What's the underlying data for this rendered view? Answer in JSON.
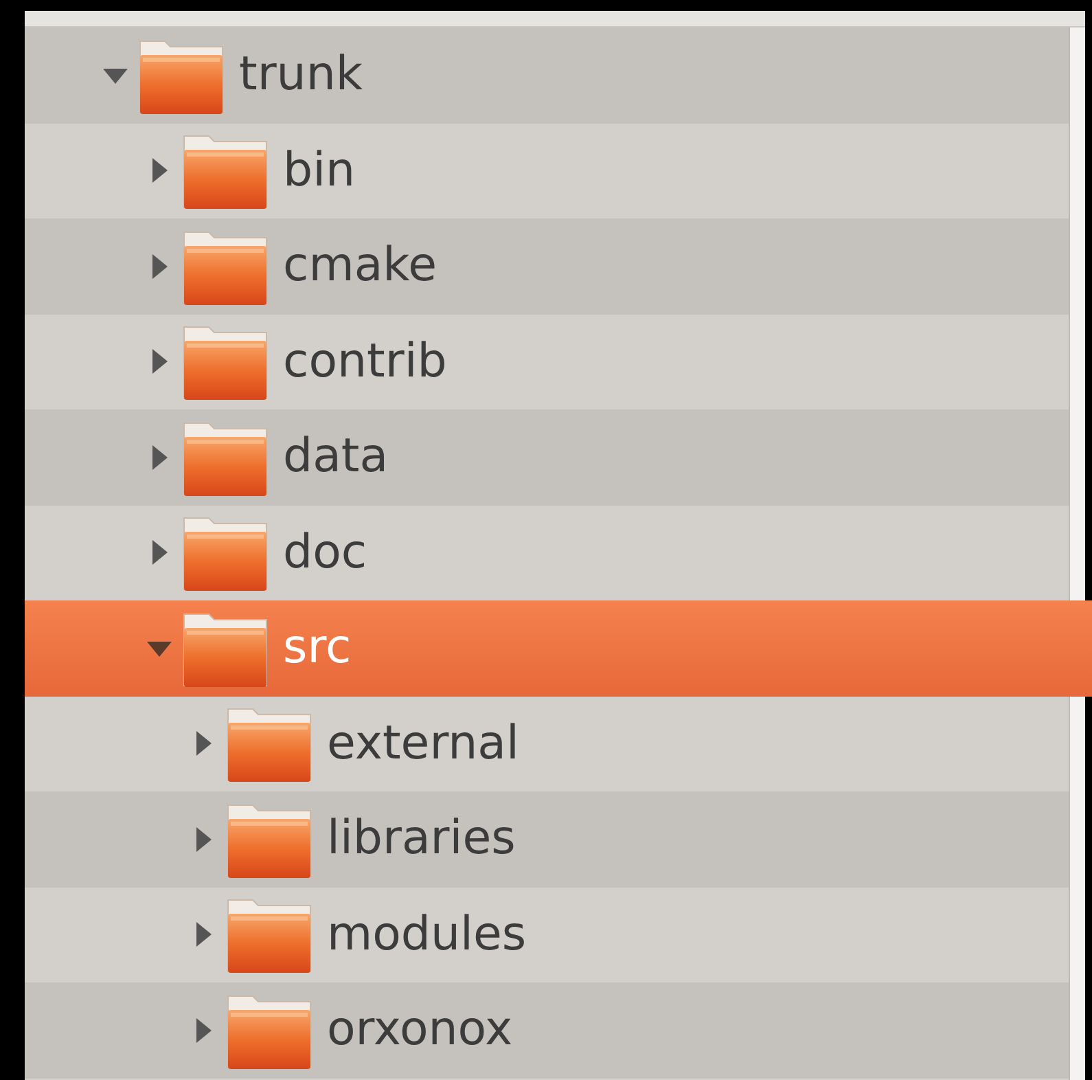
{
  "tree": [
    {
      "label": "trunk",
      "expanded": true,
      "selected": false,
      "children": [
        {
          "label": "bin",
          "expanded": false,
          "selected": false
        },
        {
          "label": "cmake",
          "expanded": false,
          "selected": false
        },
        {
          "label": "contrib",
          "expanded": false,
          "selected": false
        },
        {
          "label": "data",
          "expanded": false,
          "selected": false
        },
        {
          "label": "doc",
          "expanded": false,
          "selected": false
        },
        {
          "label": "src",
          "expanded": true,
          "selected": true,
          "children": [
            {
              "label": "external",
              "expanded": false,
              "selected": false
            },
            {
              "label": "libraries",
              "expanded": false,
              "selected": false
            },
            {
              "label": "modules",
              "expanded": false,
              "selected": false
            },
            {
              "label": "orxonox",
              "expanded": false,
              "selected": false
            }
          ]
        }
      ]
    }
  ]
}
